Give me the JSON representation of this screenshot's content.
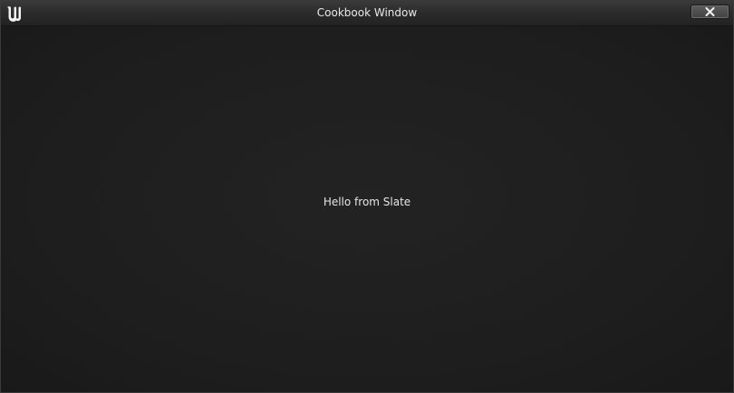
{
  "window": {
    "title": "Cookbook Window",
    "logo_icon": "unreal-engine-logo-icon",
    "close_icon": "close-icon"
  },
  "content": {
    "message": "Hello from Slate"
  },
  "colors": {
    "background": "#1d1d1d",
    "titlebar": "#2c2c2c",
    "text": "#e6e6e6"
  }
}
